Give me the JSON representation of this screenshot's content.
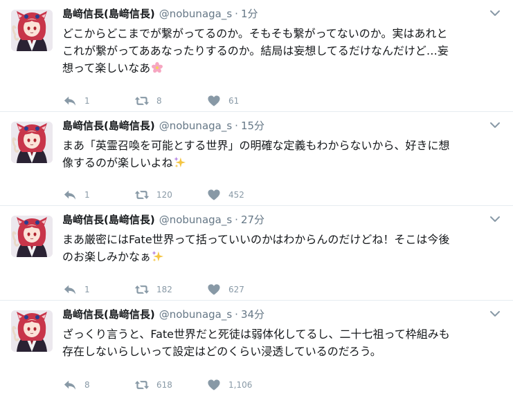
{
  "icons": {
    "reply": "reply-icon",
    "retweet": "retweet-icon",
    "like": "heart-icon",
    "more": "chevron-down-icon",
    "avatar": "avatar"
  },
  "colors": {
    "secondary_text": "#657786",
    "action_icon": "#8899a6",
    "divider": "#e6ecf0"
  },
  "tweets": [
    {
      "name": "島﨑信長(島﨑信長)",
      "handle": "@nobunaga_s",
      "separator": "·",
      "time": "1分",
      "text": "どこからどこまでが繋がってるのか。そもそも繋がってないのか。実はあれと\nこれが繋がってああなったりするのか。結局は妄想してるだけなんだけど…妄\n想って楽しいなあ",
      "emoji": "cherry-blossom-emoji",
      "replies": "1",
      "retweets": "8",
      "likes": "61"
    },
    {
      "name": "島﨑信長(島﨑信長)",
      "handle": "@nobunaga_s",
      "separator": "·",
      "time": "15分",
      "text": "まあ「英霊召喚を可能とする世界」の明確な定義もわからないから、好きに想\n像するのが楽しいよね",
      "emoji": "sparkles-emoji",
      "replies": "1",
      "retweets": "120",
      "likes": "452"
    },
    {
      "name": "島﨑信長(島﨑信長)",
      "handle": "@nobunaga_s",
      "separator": "·",
      "time": "27分",
      "text": "まあ厳密にはFate世界って括っていいのかはわからんのだけどね！そこは今後\nのお楽しみかなぁ",
      "emoji": "sparkles-emoji",
      "replies": "1",
      "retweets": "182",
      "likes": "627"
    },
    {
      "name": "島﨑信長(島﨑信長)",
      "handle": "@nobunaga_s",
      "separator": "·",
      "time": "34分",
      "text": "ざっくり言うと、Fate世界だと死徒は弱体化してるし、二十七祖って枠組みも\n存在しないらしいって設定はどのくらい浸透しているのだろう。",
      "emoji": "",
      "replies": "8",
      "retweets": "618",
      "likes": "1,106"
    }
  ]
}
